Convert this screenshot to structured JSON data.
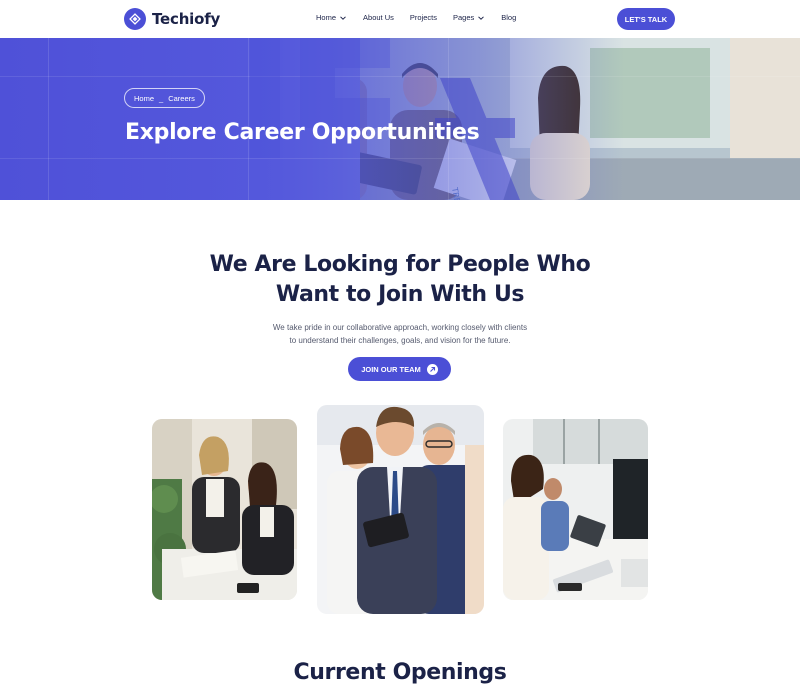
{
  "brand": {
    "name": "Techiofy",
    "accent": "#4b4fd6",
    "dark_text": "#1b2247"
  },
  "nav": {
    "items": [
      {
        "label": "Home",
        "has_dropdown": true
      },
      {
        "label": "About Us",
        "has_dropdown": false
      },
      {
        "label": "Projects",
        "has_dropdown": false
      },
      {
        "label": "Pages",
        "has_dropdown": true
      },
      {
        "label": "Blog",
        "has_dropdown": false
      }
    ],
    "cta_label": "LET'S TALK"
  },
  "hero": {
    "breadcrumb": {
      "home": "Home",
      "separator": "_",
      "current": "Careers"
    },
    "title": "Explore Career Opportunities"
  },
  "intro": {
    "title_line1": "We Are Looking for People Who",
    "title_line2": "Want to Join With Us",
    "desc_line1": "We take pride in our collaborative approach, working closely with clients",
    "desc_line2": "to understand their challenges, goals, and vision for the future.",
    "button_label": "JOIN OUR TEAM"
  },
  "openings": {
    "title": "Current Openings"
  }
}
